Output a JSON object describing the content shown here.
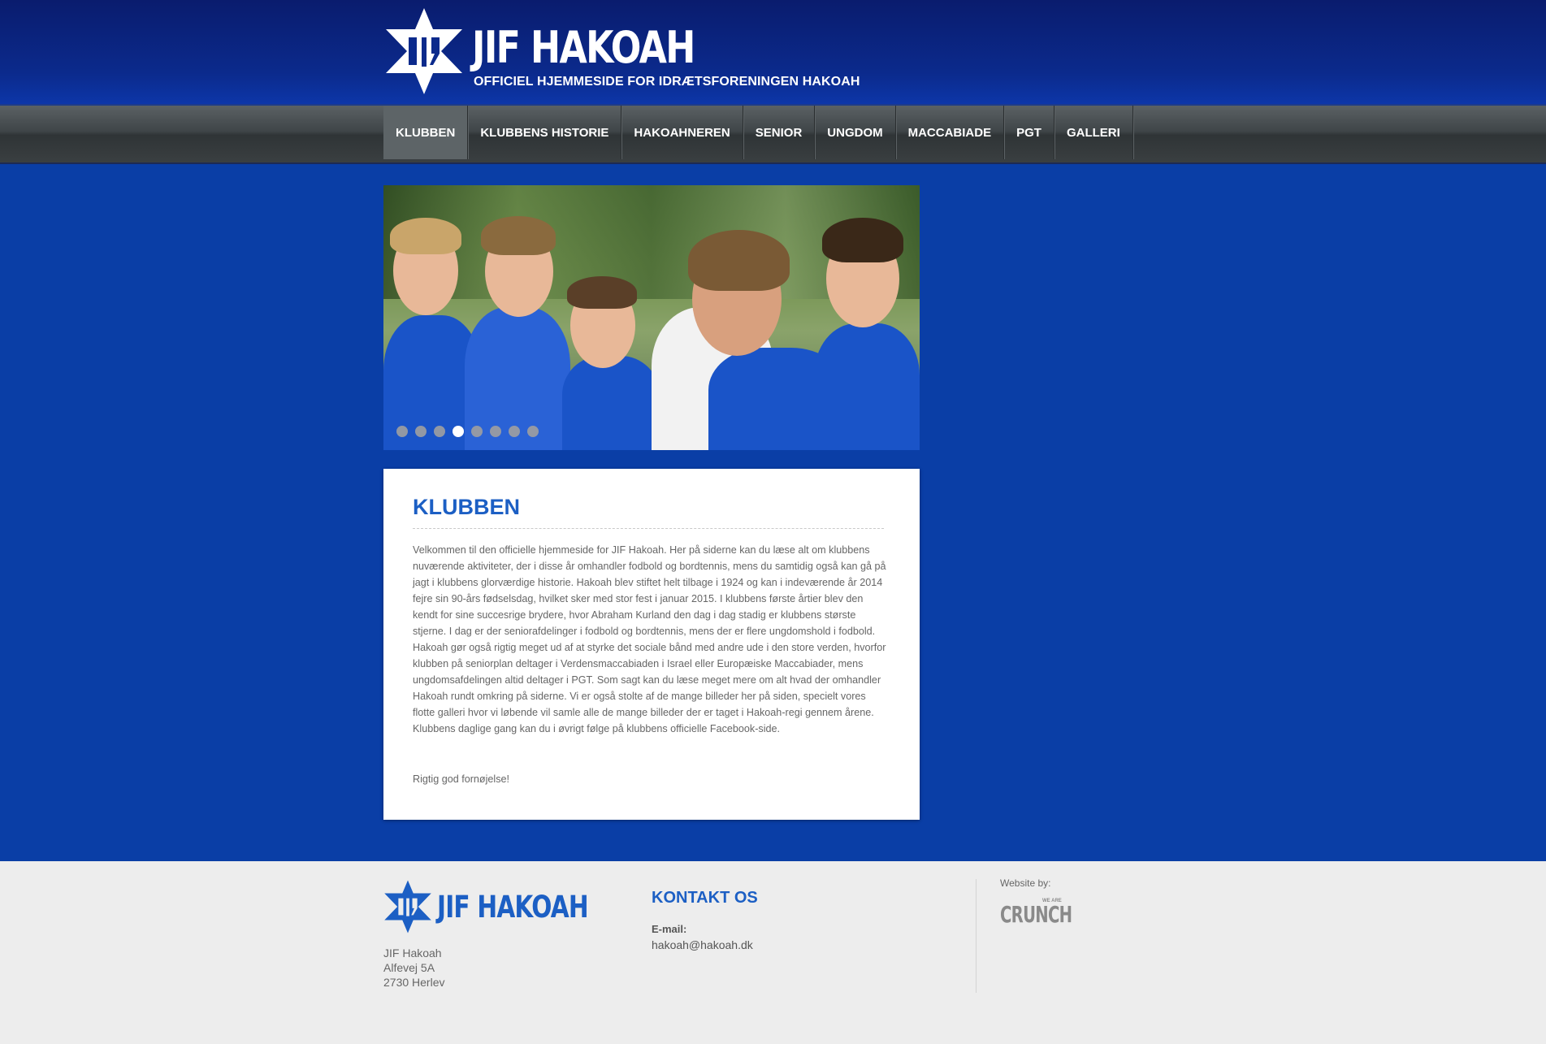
{
  "header": {
    "logo_text": "JIF HAKOAH",
    "tagline": "OFFICIEL HJEMMESIDE FOR IDRÆTSFORENINGEN HAKOAH"
  },
  "nav": {
    "items": [
      {
        "label": "KLUBBEN",
        "active": true
      },
      {
        "label": "KLUBBENS HISTORIE",
        "active": false
      },
      {
        "label": "HAKOAHNEREN",
        "active": false
      },
      {
        "label": "SENIOR",
        "active": false
      },
      {
        "label": "UNGDOM",
        "active": false
      },
      {
        "label": "MACCABIADE",
        "active": false
      },
      {
        "label": "PGT",
        "active": false
      },
      {
        "label": "GALLERI",
        "active": false
      }
    ]
  },
  "slider": {
    "slide_count": 8,
    "active_slide": 4
  },
  "content": {
    "title": "KLUBBEN",
    "body": "Velkommen til den officielle hjemmeside for JIF Hakoah. Her på siderne kan du læse alt om klubbens nuværende aktiviteter, der i disse år omhandler fodbold og bordtennis, mens du samtidig også kan gå på jagt i klubbens glorværdige historie. Hakoah blev stiftet helt tilbage i 1924 og kan i indeværende år 2014 fejre sin 90-års fødselsdag, hvilket sker med stor fest i januar 2015. I klubbens første årtier blev den kendt for sine succesrige brydere, hvor Abraham Kurland den dag i dag stadig er klubbens største stjerne. I dag er der seniorafdelinger i fodbold og bordtennis, mens der er flere ungdomshold i fodbold. Hakoah gør også rigtig meget ud af at styrke det sociale bånd med andre ude i den store verden, hvorfor klubben på seniorplan deltager i Verdensmaccabiaden i Israel eller Europæiske Maccabiader, mens ungdomsafdelingen altid deltager i PGT. Som sagt kan du læse meget mere om alt hvad der omhandler Hakoah rundt omkring på siderne. Vi er også stolte af de mange billeder her på siden, specielt vores flotte galleri hvor vi løbende vil samle alle de mange billeder der er taget i Hakoah-regi gennem årene. Klubbens daglige gang kan du i øvrigt følge på klubbens officielle Facebook-side.",
    "greeting": "Rigtig god fornøjelse!"
  },
  "footer": {
    "logo_text": "JIF HAKOAH",
    "address": [
      "JIF Hakoah",
      "Alfevej 5A",
      "2730 Herlev"
    ],
    "contact_heading": "KONTAKT OS",
    "email_label": "E-mail:",
    "email_value": "hakoah@hakoah.dk",
    "credit_label": "Website by:",
    "credit_small": "WE ARE",
    "credit_name": "CRUNCH"
  },
  "colors": {
    "brand_blue": "#1c5fc4",
    "page_background": "#0a3ea6",
    "nav_active": "#5d6467",
    "footer_background": "#ededed"
  },
  "icons": {
    "logo_icon": "star-of-david-icon"
  }
}
